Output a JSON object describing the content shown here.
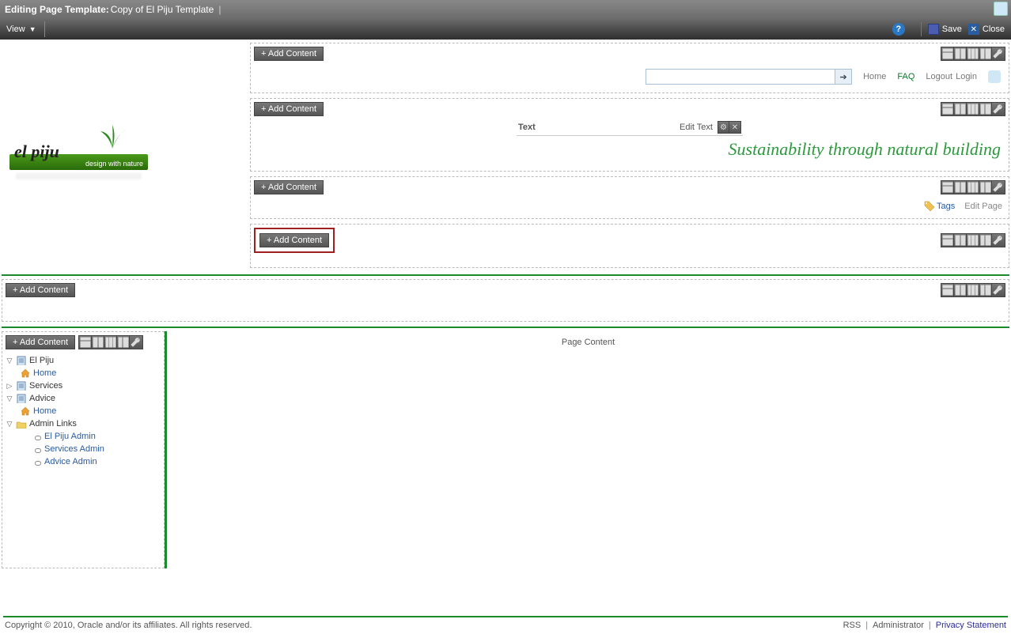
{
  "titlebar": {
    "label": "Editing Page Template:",
    "name": "Copy of El Piju Template"
  },
  "toolbar": {
    "view": "View",
    "save": "Save",
    "close": "Close"
  },
  "addContent": "+ Add Content",
  "headerLinks": {
    "home": "Home",
    "faq": "FAQ",
    "logout": "Logout",
    "login": "Login"
  },
  "logo": {
    "name": "el piju",
    "tagline": "design with nature"
  },
  "textRegion": {
    "label": "Text",
    "edit": "Edit Text",
    "slogan": "Sustainability through natural building"
  },
  "tagsRow": {
    "tags": "Tags",
    "editPage": "Edit Page"
  },
  "pageContent": "Page Content",
  "tree": {
    "n1": "El Piju",
    "n1a": "Home",
    "n2": "Services",
    "n3": "Advice",
    "n3a": "Home",
    "n4": "Admin Links",
    "n4a": "El Piju Admin",
    "n4b": "Services Admin",
    "n4c": "Advice Admin"
  },
  "footer": {
    "copyright": "Copyright © 2010, Oracle and/or its affiliates. All rights reserved.",
    "rss": "RSS",
    "admin": "Administrator",
    "privacy": "Privacy Statement"
  }
}
